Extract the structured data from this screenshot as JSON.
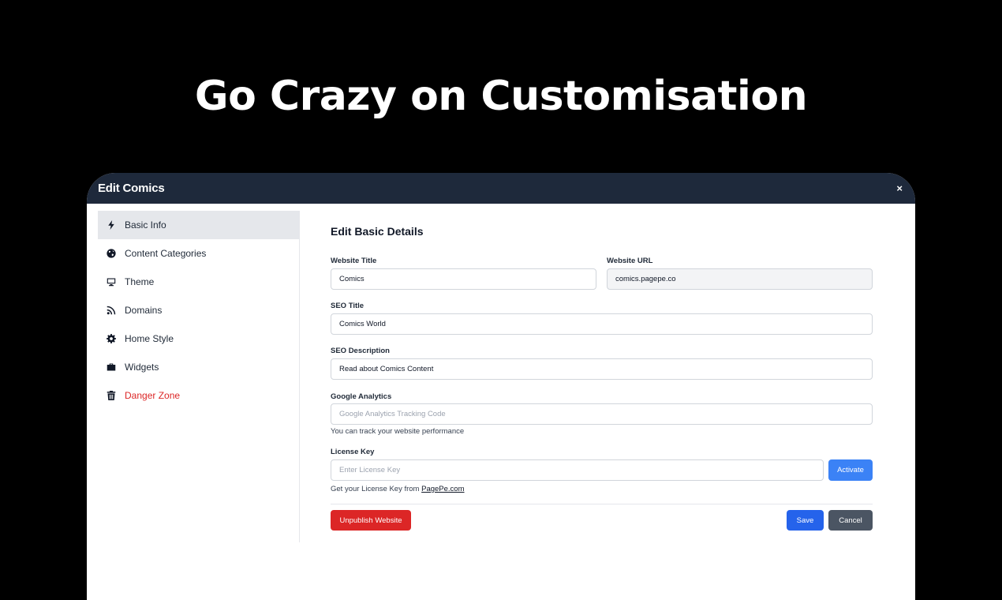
{
  "hero": {
    "title": "Go Crazy on Customisation"
  },
  "modal": {
    "title": "Edit Comics",
    "close_label": "×"
  },
  "sidebar": {
    "items": [
      {
        "label": "Basic Info",
        "icon": "bolt-icon"
      },
      {
        "label": "Content Categories",
        "icon": "globe-icon"
      },
      {
        "label": "Theme",
        "icon": "monitor-icon"
      },
      {
        "label": "Domains",
        "icon": "rss-icon"
      },
      {
        "label": "Home Style",
        "icon": "gear-icon"
      },
      {
        "label": "Widgets",
        "icon": "briefcase-icon"
      },
      {
        "label": "Danger Zone",
        "icon": "trash-icon"
      }
    ]
  },
  "form": {
    "section_title": "Edit Basic Details",
    "website_title": {
      "label": "Website Title",
      "value": "Comics"
    },
    "website_url": {
      "label": "Website URL",
      "value": "comics.pagepe.co"
    },
    "seo_title": {
      "label": "SEO Title",
      "value": "Comics World"
    },
    "seo_description": {
      "label": "SEO Description",
      "value": "Read about Comics Content"
    },
    "google_analytics": {
      "label": "Google Analytics",
      "placeholder": "Google Analytics Tracking Code",
      "help": "You can track your website performance"
    },
    "license_key": {
      "label": "License Key",
      "placeholder": "Enter License Key",
      "help_prefix": "Get your License Key from ",
      "help_link": "PagePe.com",
      "activate_label": "Activate"
    },
    "unpublish_label": "Unpublish Website",
    "save_label": "Save",
    "cancel_label": "Cancel"
  },
  "colors": {
    "header_bg": "#1e293b",
    "accent_blue": "#2563eb",
    "danger_red": "#dc2626",
    "cancel_gray": "#4b5563"
  }
}
